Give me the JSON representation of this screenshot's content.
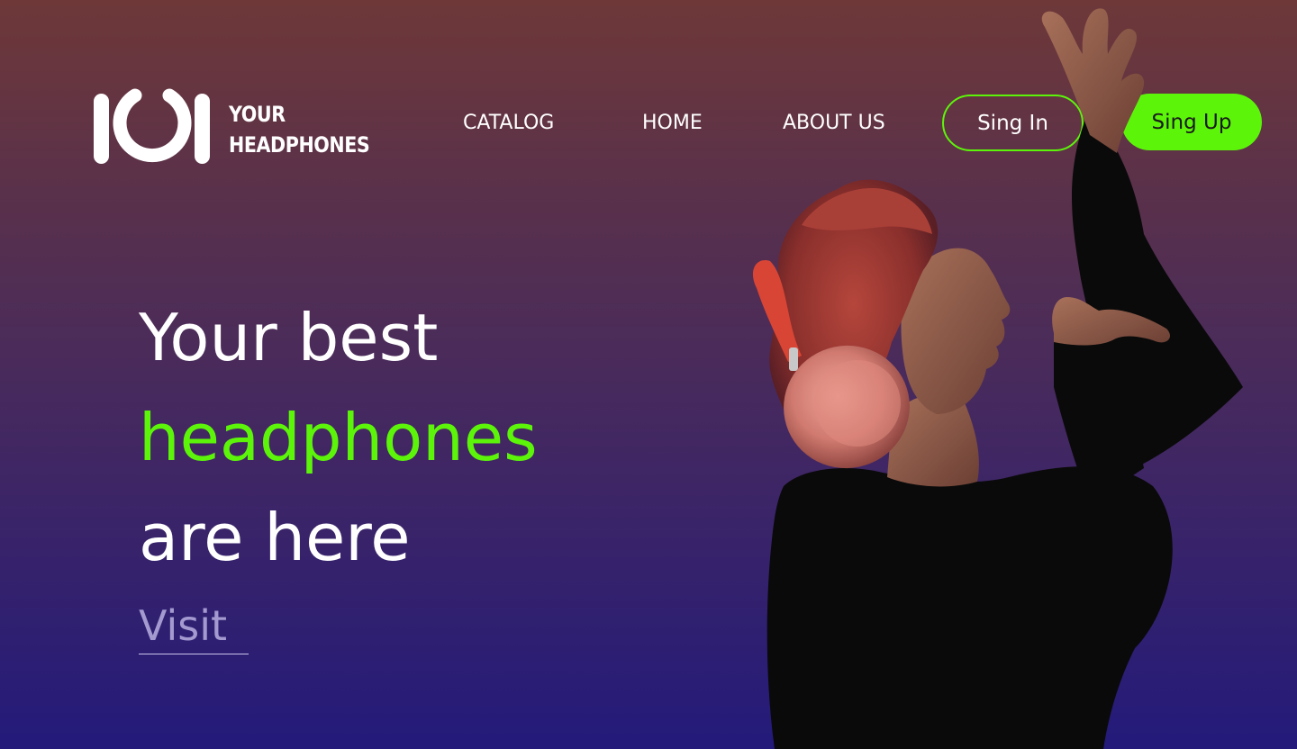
{
  "brand": {
    "line1": "YOUR",
    "line2": "HEADPHONES"
  },
  "nav": {
    "items": [
      {
        "label": "CATALOG"
      },
      {
        "label": "HOME"
      },
      {
        "label": "ABOUT US"
      }
    ]
  },
  "auth": {
    "sign_in": "Sing In",
    "sign_up": "Sing Up"
  },
  "hero": {
    "line1": "Your best",
    "line2": "headphones",
    "line3": "are here",
    "cta": "Visit"
  },
  "colors": {
    "accent": "#5cf50a",
    "background_top": "#6e3838",
    "background_bottom": "#231a7a",
    "cta_text": "#a49ad0"
  },
  "icons": [
    "headphones-logo-icon"
  ]
}
